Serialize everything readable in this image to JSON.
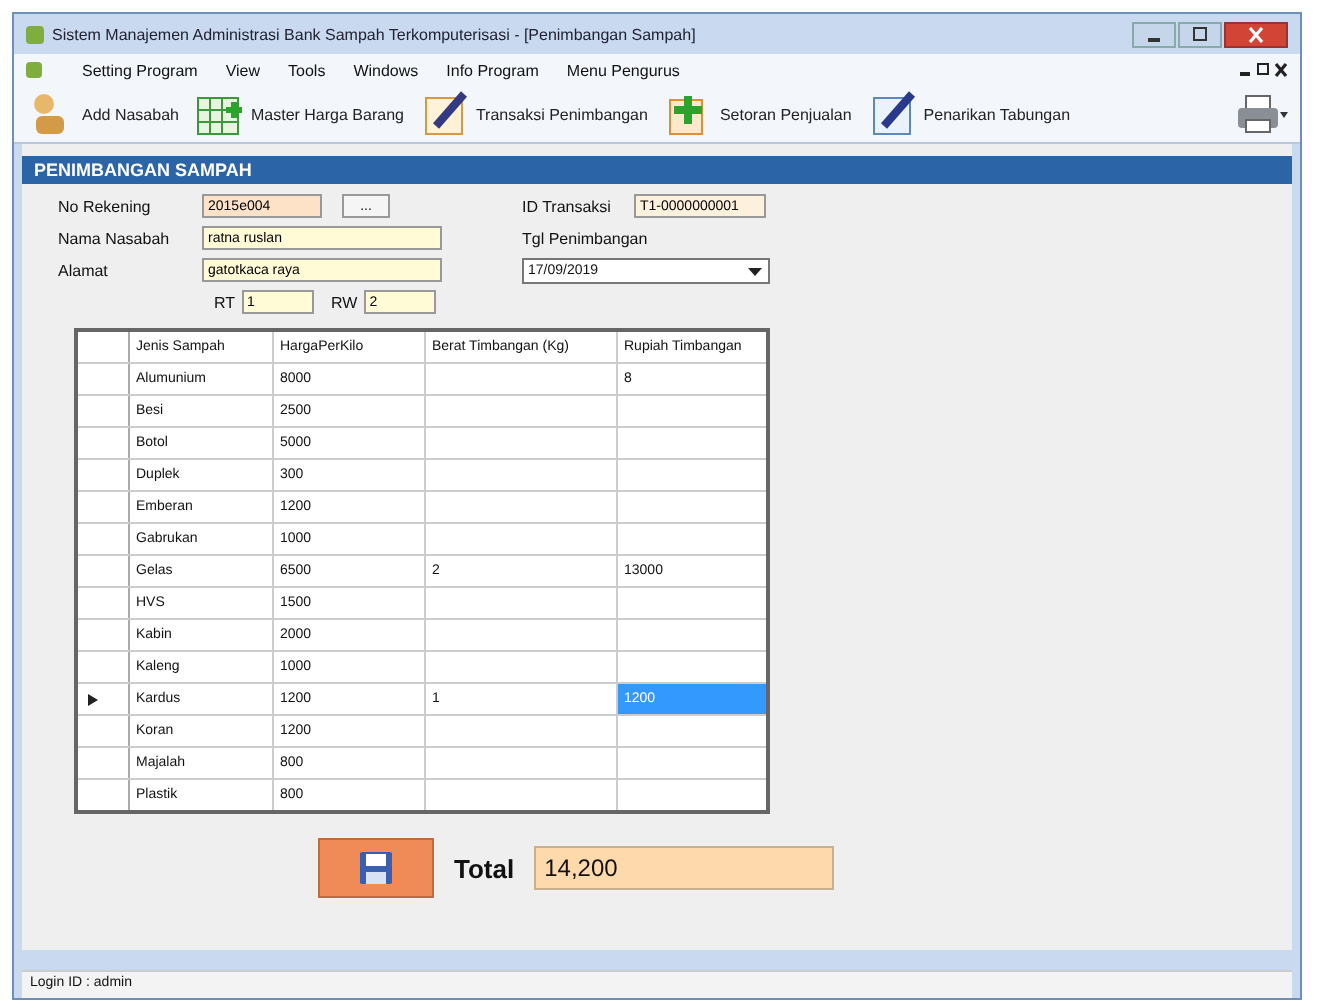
{
  "window": {
    "title": "Sistem Manajemen Administrasi Bank Sampah Terkomputerisasi - [Penimbangan Sampah]"
  },
  "menu": [
    "Setting Program",
    "View",
    "Tools",
    "Windows",
    "Info Program",
    "Menu Pengurus"
  ],
  "toolbar": [
    {
      "label": "Add Nasabah",
      "kind": "person"
    },
    {
      "label": "Master Harga Barang",
      "kind": "grid"
    },
    {
      "label": "Transaksi Penimbangan",
      "kind": "pen"
    },
    {
      "label": "Setoran Penjualan",
      "kind": "plus"
    },
    {
      "label": "Penarikan Tabungan",
      "kind": "pen2"
    }
  ],
  "section_title": "PENIMBANGAN SAMPAH",
  "form": {
    "no_rekening": {
      "label": "No Rekening",
      "value": "2015e004",
      "button": "..."
    },
    "nama_nasabah": {
      "label": "Nama Nasabah",
      "value": "ratna ruslan"
    },
    "alamat": {
      "label": "Alamat",
      "value": "gatotkaca raya"
    },
    "rt": {
      "label": "RT",
      "value": "1"
    },
    "rw": {
      "label": "RW",
      "value": "2"
    },
    "id_transaksi": {
      "label": "ID Transaksi",
      "value": "T1-0000000001"
    },
    "tgl_penimbangan": {
      "label": "Tgl Penimbangan",
      "value": "17/09/2019"
    }
  },
  "table": {
    "columns": [
      "Jenis Sampah",
      "HargaPerKilo",
      "Berat Timbangan (Kg)",
      "Rupiah Timbangan"
    ],
    "rows": [
      {
        "cells": [
          "Alumunium",
          "8000",
          "",
          "8"
        ],
        "selected": false
      },
      {
        "cells": [
          "Besi",
          "2500",
          "",
          ""
        ],
        "selected": false
      },
      {
        "cells": [
          "Botol",
          "5000",
          "",
          ""
        ],
        "selected": false
      },
      {
        "cells": [
          "Duplek",
          "300",
          "",
          ""
        ],
        "selected": false
      },
      {
        "cells": [
          "Emberan",
          "1200",
          "",
          ""
        ],
        "selected": false
      },
      {
        "cells": [
          "Gabrukan",
          "1000",
          "",
          ""
        ],
        "selected": false
      },
      {
        "cells": [
          "Gelas",
          "6500",
          "2",
          "13000"
        ],
        "selected": false
      },
      {
        "cells": [
          "HVS",
          "1500",
          "",
          ""
        ],
        "selected": false
      },
      {
        "cells": [
          "Kabin",
          "2000",
          "",
          ""
        ],
        "selected": false
      },
      {
        "cells": [
          "Kaleng",
          "1000",
          "",
          ""
        ],
        "selected": false
      },
      {
        "cells": [
          "Kardus",
          "1200",
          "1",
          "1200"
        ],
        "selected": true
      },
      {
        "cells": [
          "Koran",
          "1200",
          "",
          ""
        ],
        "selected": false
      },
      {
        "cells": [
          "Majalah",
          "800",
          "",
          ""
        ],
        "selected": false
      },
      {
        "cells": [
          "Plastik",
          "800",
          "",
          ""
        ],
        "selected": false
      }
    ]
  },
  "total": {
    "label": "Total",
    "value": "14,200"
  },
  "status_bar": "Login ID : admin"
}
